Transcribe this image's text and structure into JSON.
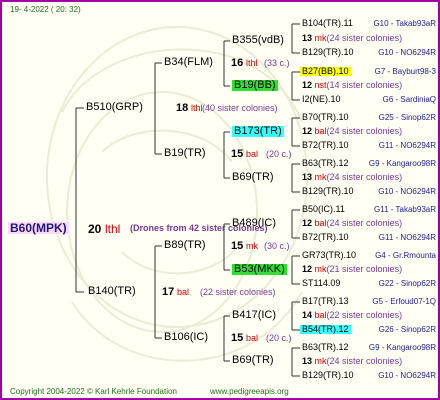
{
  "header": {
    "date": "19-  4-2022 ( 20: 32)"
  },
  "footer": {
    "copyright": "Copyright 2004-2022 © Karl Kehrle Foundation",
    "site": "www.pedigreeapis.org"
  },
  "colors": {
    "frame": "#a000a0",
    "queen": "#ffd8ff",
    "link": "#2020a0",
    "year": "#d00000"
  },
  "root": {
    "name": "B60(MPK)",
    "num": "20",
    "type": "lthl",
    "note": "(Drones from 42 sister colonies)"
  },
  "g1": [
    {
      "name": "B510(GRP)",
      "num": "18",
      "type": "lthl",
      "note": "(40 sister colonies)"
    },
    {
      "name": "B140(TR)",
      "num": "17",
      "type": "bal",
      "note": "(22 sister colonies)"
    }
  ],
  "g2": [
    {
      "name": "B34(FLM)",
      "num": "16",
      "type": "lthl",
      "note": "(33 c.)"
    },
    {
      "name": "B19(TR)",
      "num": "15",
      "type": "bal",
      "note": "(20 c.)"
    },
    {
      "name": "B89(TR)",
      "num": "15",
      "type": "mk",
      "note": "(30 c.)"
    },
    {
      "name": "B106(IC)",
      "num": "15",
      "type": "bal",
      "note": "(20 c.)"
    }
  ],
  "g3": [
    {
      "name": "B355(vdB)"
    },
    {
      "name": "B19(BB)"
    },
    {
      "name": "B173(TR)"
    },
    {
      "name": "B69(TR)"
    },
    {
      "name": "B489(IC)"
    },
    {
      "name": "B53(MKK)"
    },
    {
      "name": "B417(IC)"
    },
    {
      "name": "B69(TR)"
    }
  ],
  "g3_notes": [
    {
      "num": "13",
      "type": "mk",
      "note": "(24 sister colonies)"
    },
    {
      "num": "12",
      "type": "nst",
      "note": "(14 sister colonies)"
    },
    {
      "num": "12",
      "type": "bal",
      "note": "(24 sister colonies)"
    },
    {
      "num": "13",
      "type": "mk",
      "note": "(24 sister colonies)"
    },
    {
      "num": "12",
      "type": "bal",
      "note": "(24 sister colonies)"
    },
    {
      "num": "12",
      "type": "mk",
      "note": "(21 sister colonies)"
    },
    {
      "num": "14",
      "type": "bal",
      "note": "(22 sister colonies)"
    },
    {
      "num": "13",
      "type": "mk",
      "note": "(24 sister colonies)"
    }
  ],
  "g4": [
    {
      "name": "B104(TR).11",
      "ref": "G10 - Takab93aR"
    },
    {
      "name": "B129(TR).10",
      "ref": "G10 - NO6294R"
    },
    {
      "name": "B27(BB).10",
      "ref": "G7 - Bayburt98-3"
    },
    {
      "name": "I2(NE).10",
      "ref": "G6 - SardiniaQ"
    },
    {
      "name": "B70(TR).10",
      "ref": "G25 - Sinop62R"
    },
    {
      "name": "B72(TR).10",
      "ref": "G11 - NO6294R"
    },
    {
      "name": "B63(TR).12",
      "ref": "G9 - Kangaroo98R"
    },
    {
      "name": "B129(TR).10",
      "ref": "G10 - NO6294R"
    },
    {
      "name": "B50(IC).11",
      "ref": "G11 - Takab93aR"
    },
    {
      "name": "B72(TR).10",
      "ref": "G11 - NO6294R"
    },
    {
      "name": "GR73(TR).10",
      "ref": "G4 - Gr.Rmounta"
    },
    {
      "name": "ST114.09",
      "ref": "G22 - Sinop62R"
    },
    {
      "name": "B17(TR).13",
      "ref": "G5 - Erfoud07-1Q"
    },
    {
      "name": "B54(TR).12",
      "ref": "G26 - Sinop62R"
    },
    {
      "name": "B63(TR).12",
      "ref": "G9 - Kangaroo98R"
    },
    {
      "name": "B129(TR).10",
      "ref": "G10 - NO6294R"
    }
  ]
}
